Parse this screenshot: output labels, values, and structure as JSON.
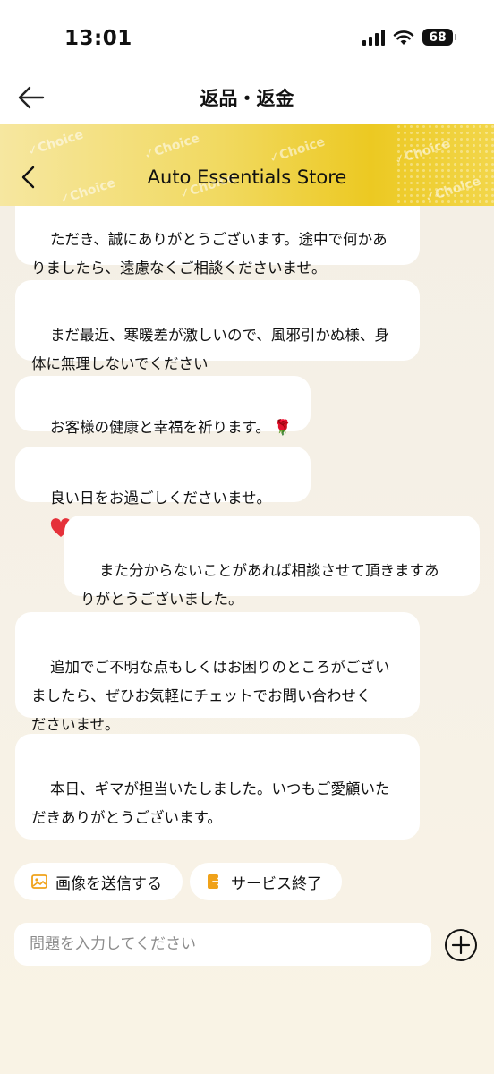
{
  "status": {
    "time": "13:01",
    "battery": "68"
  },
  "header": {
    "title": "返品・返金"
  },
  "store": {
    "name": "Auto Essentials Store",
    "watermark": "Choice"
  },
  "messages": [
    {
      "side": "left",
      "text": "ただき、誠にありがとうございます。途中で何かあ\nりましたら、遠慮なくご相談くださいませ。"
    },
    {
      "side": "left",
      "text": "まだ最近、寒暖差が激しいので、風邪引かぬ様、身\n体に無理しないでください"
    },
    {
      "side": "left",
      "text": "お客様の健康と幸福を祈ります。",
      "emoji": "🌹"
    },
    {
      "side": "left",
      "text": "良い日をお過ごしくださいませ。",
      "emoji": "❤️"
    },
    {
      "side": "right",
      "text": "また分からないことがあれば相談させて頂きますあ\nりがとうございました。"
    },
    {
      "side": "left",
      "text": "追加でご不明な点もしくはお困りのところがござい\nましたら、ぜひお気軽にチェットでお問い合わせく\nださいませ。"
    },
    {
      "side": "left",
      "text": "本日、ギマが担当いたしました。いつもご愛顧いた\nだきありがとうございます。",
      "emoji": "❤️"
    }
  ],
  "actions": {
    "send_image": "画像を送信する",
    "end_service": "サービス終了"
  },
  "input": {
    "placeholder": "問題を入力してください"
  },
  "colors": {
    "accent": "#f0a21a",
    "heart": "#e5313a",
    "header_gradient": "#ecc922"
  }
}
